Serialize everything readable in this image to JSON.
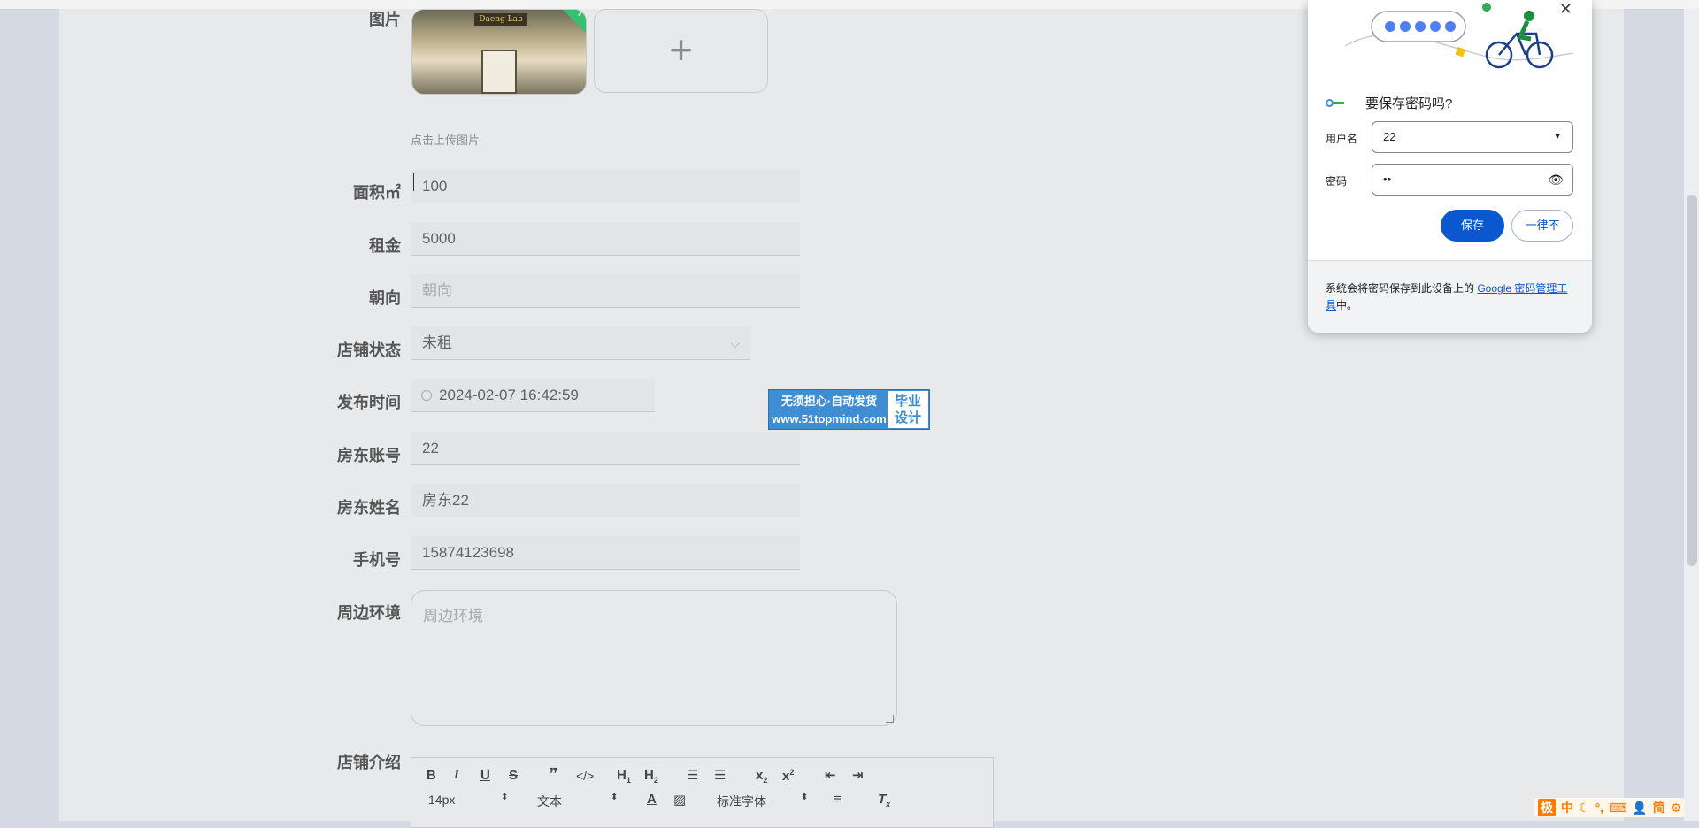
{
  "form": {
    "image_label": "图片",
    "image_thumb_sign": "Daeng Lab",
    "upload_hint": "点击上传图片",
    "area": {
      "label": "面积㎡",
      "value": "100"
    },
    "rent": {
      "label": "租金",
      "value": "5000"
    },
    "orientation": {
      "label": "朝向",
      "placeholder": "朝向"
    },
    "status": {
      "label": "店铺状态",
      "value": "未租"
    },
    "publish_time": {
      "label": "发布时间",
      "value": "2024-02-07 16:42:59"
    },
    "landlord_account": {
      "label": "房东账号",
      "value": "22"
    },
    "landlord_name": {
      "label": "房东姓名",
      "value": "房东22"
    },
    "phone": {
      "label": "手机号",
      "value": "15874123698"
    },
    "surroundings": {
      "label": "周边环境",
      "placeholder": "周边环境"
    },
    "intro": {
      "label": "店铺介绍"
    }
  },
  "editor": {
    "font_size": "14px",
    "paragraph": "文本",
    "font_family": "标准字体"
  },
  "watermark": {
    "line1": "无须担心·自动发货",
    "line2": "www.51topmind.com",
    "badge_line1": "毕业",
    "badge_line2": "设计"
  },
  "password_popup": {
    "title": "要保存密码吗?",
    "username_label": "用户名",
    "username_value": "22",
    "password_label": "密码",
    "password_value": "••",
    "save_button": "保存",
    "never_button": "一律不",
    "footer_text": "系统会将密码保存到此设备上的 ",
    "footer_link": "Google 密码管理工具",
    "footer_suffix": "中。"
  },
  "ime": {
    "logo": "极",
    "lang": "中",
    "mode": "简"
  }
}
